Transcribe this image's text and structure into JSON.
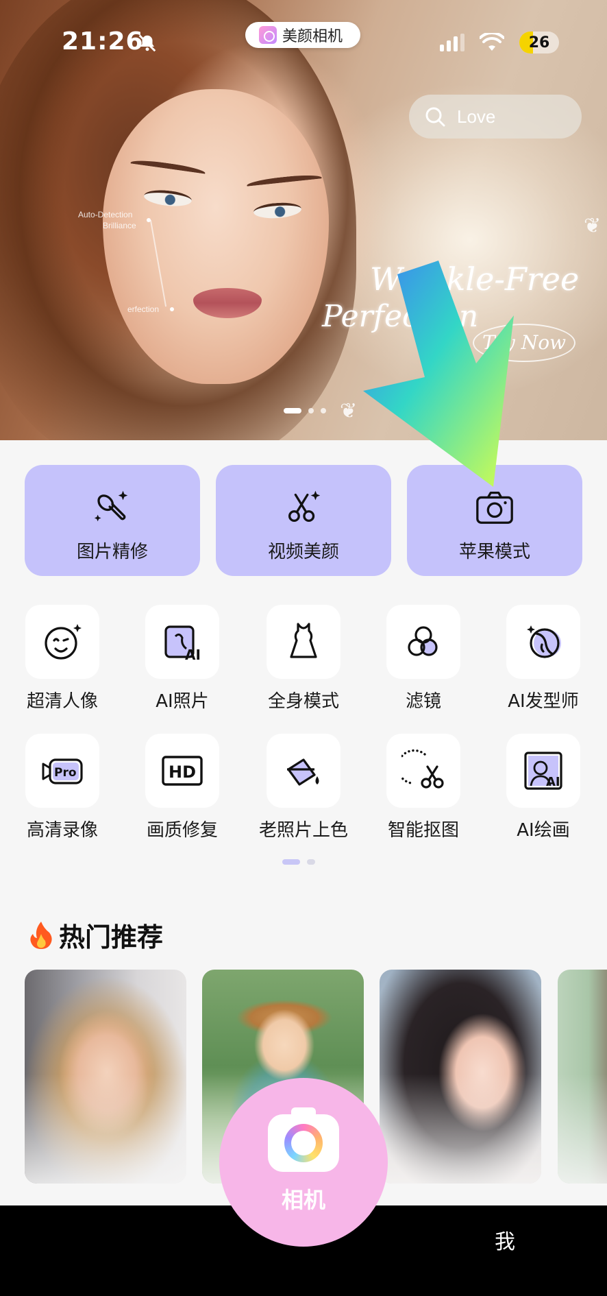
{
  "status_bar": {
    "time": "21:26",
    "app_name": "美颜相机",
    "battery": "26"
  },
  "search": {
    "placeholder": "Love"
  },
  "banner": {
    "annotation_1": "Auto-Detection",
    "annotation_2": "Brilliance",
    "annotation_3": "erfection",
    "headline_1": "Wrinkle-Free",
    "headline_2": "Perfection",
    "cta": "Try Now",
    "slides_total": 3,
    "slide_active": 1
  },
  "primary_cards": [
    {
      "label": "图片精修",
      "icon": "makeup-brush-icon"
    },
    {
      "label": "视频美颜",
      "icon": "video-scissors-icon"
    },
    {
      "label": "苹果模式",
      "icon": "camera-icon"
    }
  ],
  "tools": [
    {
      "label": "超清人像",
      "icon": "smile-face-icon"
    },
    {
      "label": "AI照片",
      "icon": "ai-photo-icon"
    },
    {
      "label": "全身模式",
      "icon": "dress-icon"
    },
    {
      "label": "滤镜",
      "icon": "filter-circles-icon"
    },
    {
      "label": "AI发型师",
      "icon": "hair-stylist-icon"
    },
    {
      "label": "高清录像",
      "icon": "pro-video-icon"
    },
    {
      "label": "画质修复",
      "icon": "hd-icon"
    },
    {
      "label": "老照片上色",
      "icon": "paint-bucket-icon"
    },
    {
      "label": "智能抠图",
      "icon": "cutout-scissors-icon"
    },
    {
      "label": "AI绘画",
      "icon": "ai-painting-icon"
    }
  ],
  "hot_section": {
    "title": "热门推荐"
  },
  "bottom_nav": {
    "camera_label": "相机",
    "me_label": "我"
  },
  "colors": {
    "card_bg": "#c5c2fb",
    "camera_button": "#f7b6e8",
    "page_bg": "#f6f6f6"
  }
}
